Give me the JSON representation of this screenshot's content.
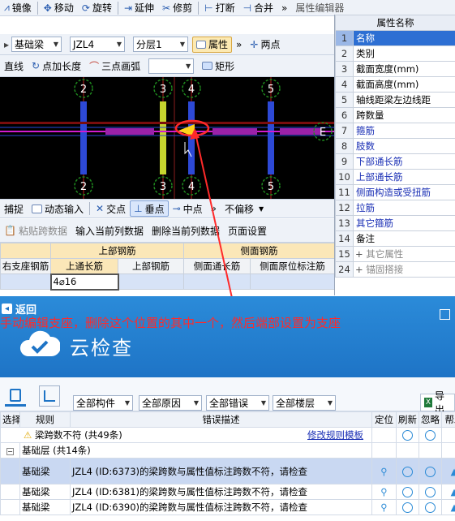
{
  "toolbar1": {
    "mirror": "镜像",
    "move": "移动",
    "rotate": "旋转",
    "extend": "延伸",
    "trim": "修剪",
    "break": "打断",
    "merge": "合并",
    "more": "»",
    "right_title": "属性编辑器"
  },
  "toolbar2": {
    "layer_type": "基础梁",
    "component": "JZL4",
    "floor": "分层1",
    "attributes_btn": "属性",
    "two_points": "两点"
  },
  "toolbar3": {
    "line": "直线",
    "point_length": "点加长度",
    "three_point_arc": "三点画弧",
    "rect": "矩形"
  },
  "snapbar": {
    "snap": "捕捉",
    "dynamic_input": "动态输入",
    "intersection": "交点",
    "perpendicular": "垂点",
    "midpoint": "中点",
    "no_offset": "不偏移"
  },
  "cad": {
    "axis_top": [
      "2",
      "3",
      "4",
      "5"
    ],
    "axis_bottom": [
      "2",
      "3",
      "4",
      "5"
    ],
    "axis_right": "E"
  },
  "properties": {
    "header": "属性名称",
    "rows": [
      {
        "n": "1",
        "label": "名称"
      },
      {
        "n": "2",
        "label": "类别"
      },
      {
        "n": "3",
        "label": "截面宽度(mm)"
      },
      {
        "n": "4",
        "label": "截面高度(mm)"
      },
      {
        "n": "5",
        "label": "轴线距梁左边线距"
      },
      {
        "n": "6",
        "label": "跨数量"
      },
      {
        "n": "7",
        "label": "箍筋"
      },
      {
        "n": "8",
        "label": "肢数"
      },
      {
        "n": "9",
        "label": "下部通长筋"
      },
      {
        "n": "10",
        "label": "上部通长筋"
      },
      {
        "n": "11",
        "label": "侧面构造或受扭筋"
      },
      {
        "n": "12",
        "label": "拉筋"
      },
      {
        "n": "13",
        "label": "其它箍筋"
      },
      {
        "n": "14",
        "label": "备注"
      },
      {
        "n": "15",
        "label": "其它属性"
      },
      {
        "n": "24",
        "label": "锚固搭接"
      }
    ]
  },
  "rebar_toolbar": {
    "paste": "粘贴跨数据",
    "input_col": "输入当前列数据",
    "delete_col": "删除当前列数据",
    "page_setup": "页面设置"
  },
  "rebar_table": {
    "group_top": "上部钢筋",
    "group_side": "侧面钢筋",
    "cols": [
      "右支座钢筋",
      "上通长筋",
      "上部钢筋",
      "侧面通长筋",
      "侧面原位标注筋"
    ],
    "cell_value": "4⌀16"
  },
  "annotation": "手动编辑支座，删除这个位置的其中一个，然后端部设置为支座",
  "dialog": {
    "back": "返回",
    "title": "云检查",
    "filters": [
      "全部构件",
      "全部原因",
      "全部错误",
      "全部楼层"
    ],
    "export": "导出",
    "headers": [
      "选择",
      "规则",
      "错误描述",
      "定位",
      "刷新",
      "忽略",
      "帮助"
    ],
    "group_title": "梁跨数不符 (共49条)",
    "edit_template": "修改规则模板",
    "subgroup": "基础层 (共14条)",
    "rows": [
      {
        "rule": "基础梁",
        "desc": "JZL4 (ID:6373)的梁跨数与属性值标注跨数不符，请检查"
      },
      {
        "rule": "基础梁",
        "desc": "JZL4 (ID:6381)的梁跨数与属性值标注跨数不符，请检查"
      },
      {
        "rule": "基础梁",
        "desc": "JZL4 (ID:6390)的梁跨数与属性值标注跨数不符，请检查"
      }
    ]
  }
}
